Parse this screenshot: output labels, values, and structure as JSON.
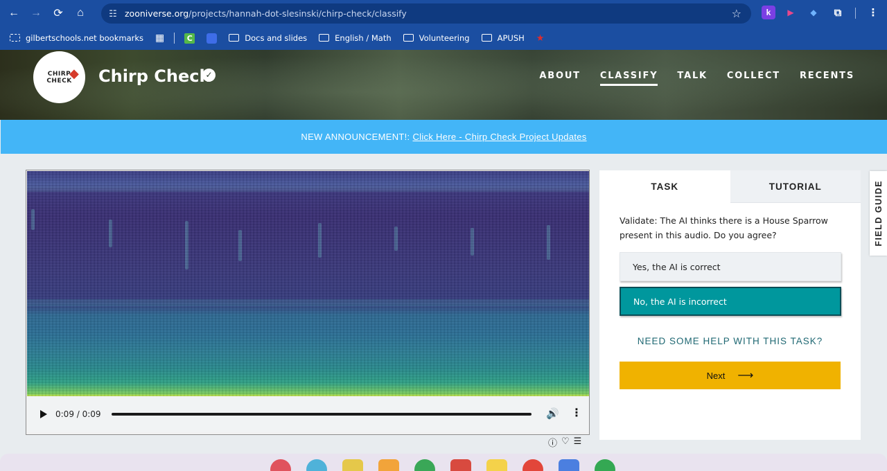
{
  "browser": {
    "url_host": "zooniverse.org",
    "url_path": "/projects/hannah-dot-slesinski/chirp-check/classify",
    "extensions": [
      {
        "name": "kami-extension-icon",
        "glyph": "k",
        "color": "#7b3fe4"
      },
      {
        "name": "screencastify-extension-icon",
        "glyph": "▶",
        "color": "#e8478b"
      },
      {
        "name": "colorful-extension-icon",
        "glyph": "◆",
        "color": "#4a8ad9"
      }
    ]
  },
  "bookmarks": {
    "items": [
      {
        "label": "gilbertschools.net bookmarks"
      },
      {
        "label": "Docs and slides"
      },
      {
        "label": "English / Math"
      },
      {
        "label": "Volunteering"
      },
      {
        "label": "APUSH"
      }
    ]
  },
  "project": {
    "title": "Chirp Check",
    "logo_text_1": "CHIRP",
    "logo_text_2": "CHECK",
    "nav": [
      {
        "label": "ABOUT"
      },
      {
        "label": "CLASSIFY",
        "active": true
      },
      {
        "label": "TALK"
      },
      {
        "label": "COLLECT"
      },
      {
        "label": "RECENTS"
      }
    ]
  },
  "announcement": {
    "prefix": "NEW ANNOUNCEMENT!:",
    "link": "Click Here - Chirp Check Project Updates"
  },
  "audio": {
    "time": "0:09 / 0:09"
  },
  "task": {
    "tabs": [
      {
        "label": "TASK"
      },
      {
        "label": "TUTORIAL"
      }
    ],
    "question": "Validate: The AI thinks there is a House Sparrow present in this audio. Do you agree?",
    "answers": [
      {
        "label": "Yes, the AI is correct",
        "selected": false
      },
      {
        "label": "No, the AI is incorrect",
        "selected": true
      }
    ],
    "help": "NEED SOME HELP WITH THIS TASK?",
    "next_label": "Next"
  },
  "field_guide": {
    "label": "FIELD GUIDE"
  },
  "colors": {
    "chrome": "#1b4ea1",
    "announcement": "#43b5f7",
    "selected_answer": "#00979d",
    "next_button": "#f0b200"
  }
}
